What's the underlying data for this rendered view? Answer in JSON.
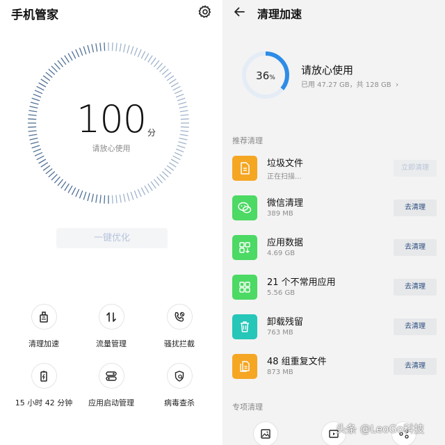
{
  "left": {
    "title": "手机管家",
    "score": "100",
    "score_unit": "分",
    "score_status": "请放心使用",
    "optimize_label": "一键优化",
    "tools": [
      {
        "label": "清理加速",
        "icon": "broom-icon"
      },
      {
        "label": "流量管理",
        "icon": "data-transfer-icon"
      },
      {
        "label": "骚扰拦截",
        "icon": "phone-block-icon"
      },
      {
        "label": "15 小时 42 分钟",
        "icon": "battery-icon"
      },
      {
        "label": "应用启动管理",
        "icon": "app-toggle-icon"
      },
      {
        "label": "病毒查杀",
        "icon": "virus-scan-icon"
      }
    ]
  },
  "right": {
    "title": "清理加速",
    "storage_percent": "36",
    "storage_percent_symbol": "%",
    "storage_fraction": 0.36,
    "status_title": "请放心使用",
    "status_sub": "已用 47.27 GB，共 128 GB",
    "section_recommended": "推荐清理",
    "section_special": "专项清理",
    "items": [
      {
        "name": "垃圾文件",
        "size": "正在扫描...",
        "button": "立即清理",
        "color": "#f5a623",
        "icon": "document-icon"
      },
      {
        "name": "微信清理",
        "size": "389 MB",
        "button": "去清理",
        "color": "#4cd964",
        "icon": "wechat-icon"
      },
      {
        "name": "应用数据",
        "size": "4.69 GB",
        "button": "去清理",
        "color": "#4cd964",
        "icon": "app-data-icon"
      },
      {
        "name": "21 个不常用应用",
        "size": "5.56 GB",
        "button": "去清理",
        "color": "#4cd964",
        "icon": "apps-grid-icon"
      },
      {
        "name": "卸载残留",
        "size": "763 MB",
        "button": "去清理",
        "color": "#26c6b8",
        "icon": "trash-icon"
      },
      {
        "name": "48 组重复文件",
        "size": "873 MB",
        "button": "去清理",
        "color": "#f5a623",
        "icon": "duplicate-files-icon"
      }
    ],
    "watermark": "头条 @LeoGo科技"
  },
  "colors": {
    "accent_blue": "#2e8ce6",
    "ring_track": "#e4ecf6",
    "button_text": "#2a4d7f"
  }
}
